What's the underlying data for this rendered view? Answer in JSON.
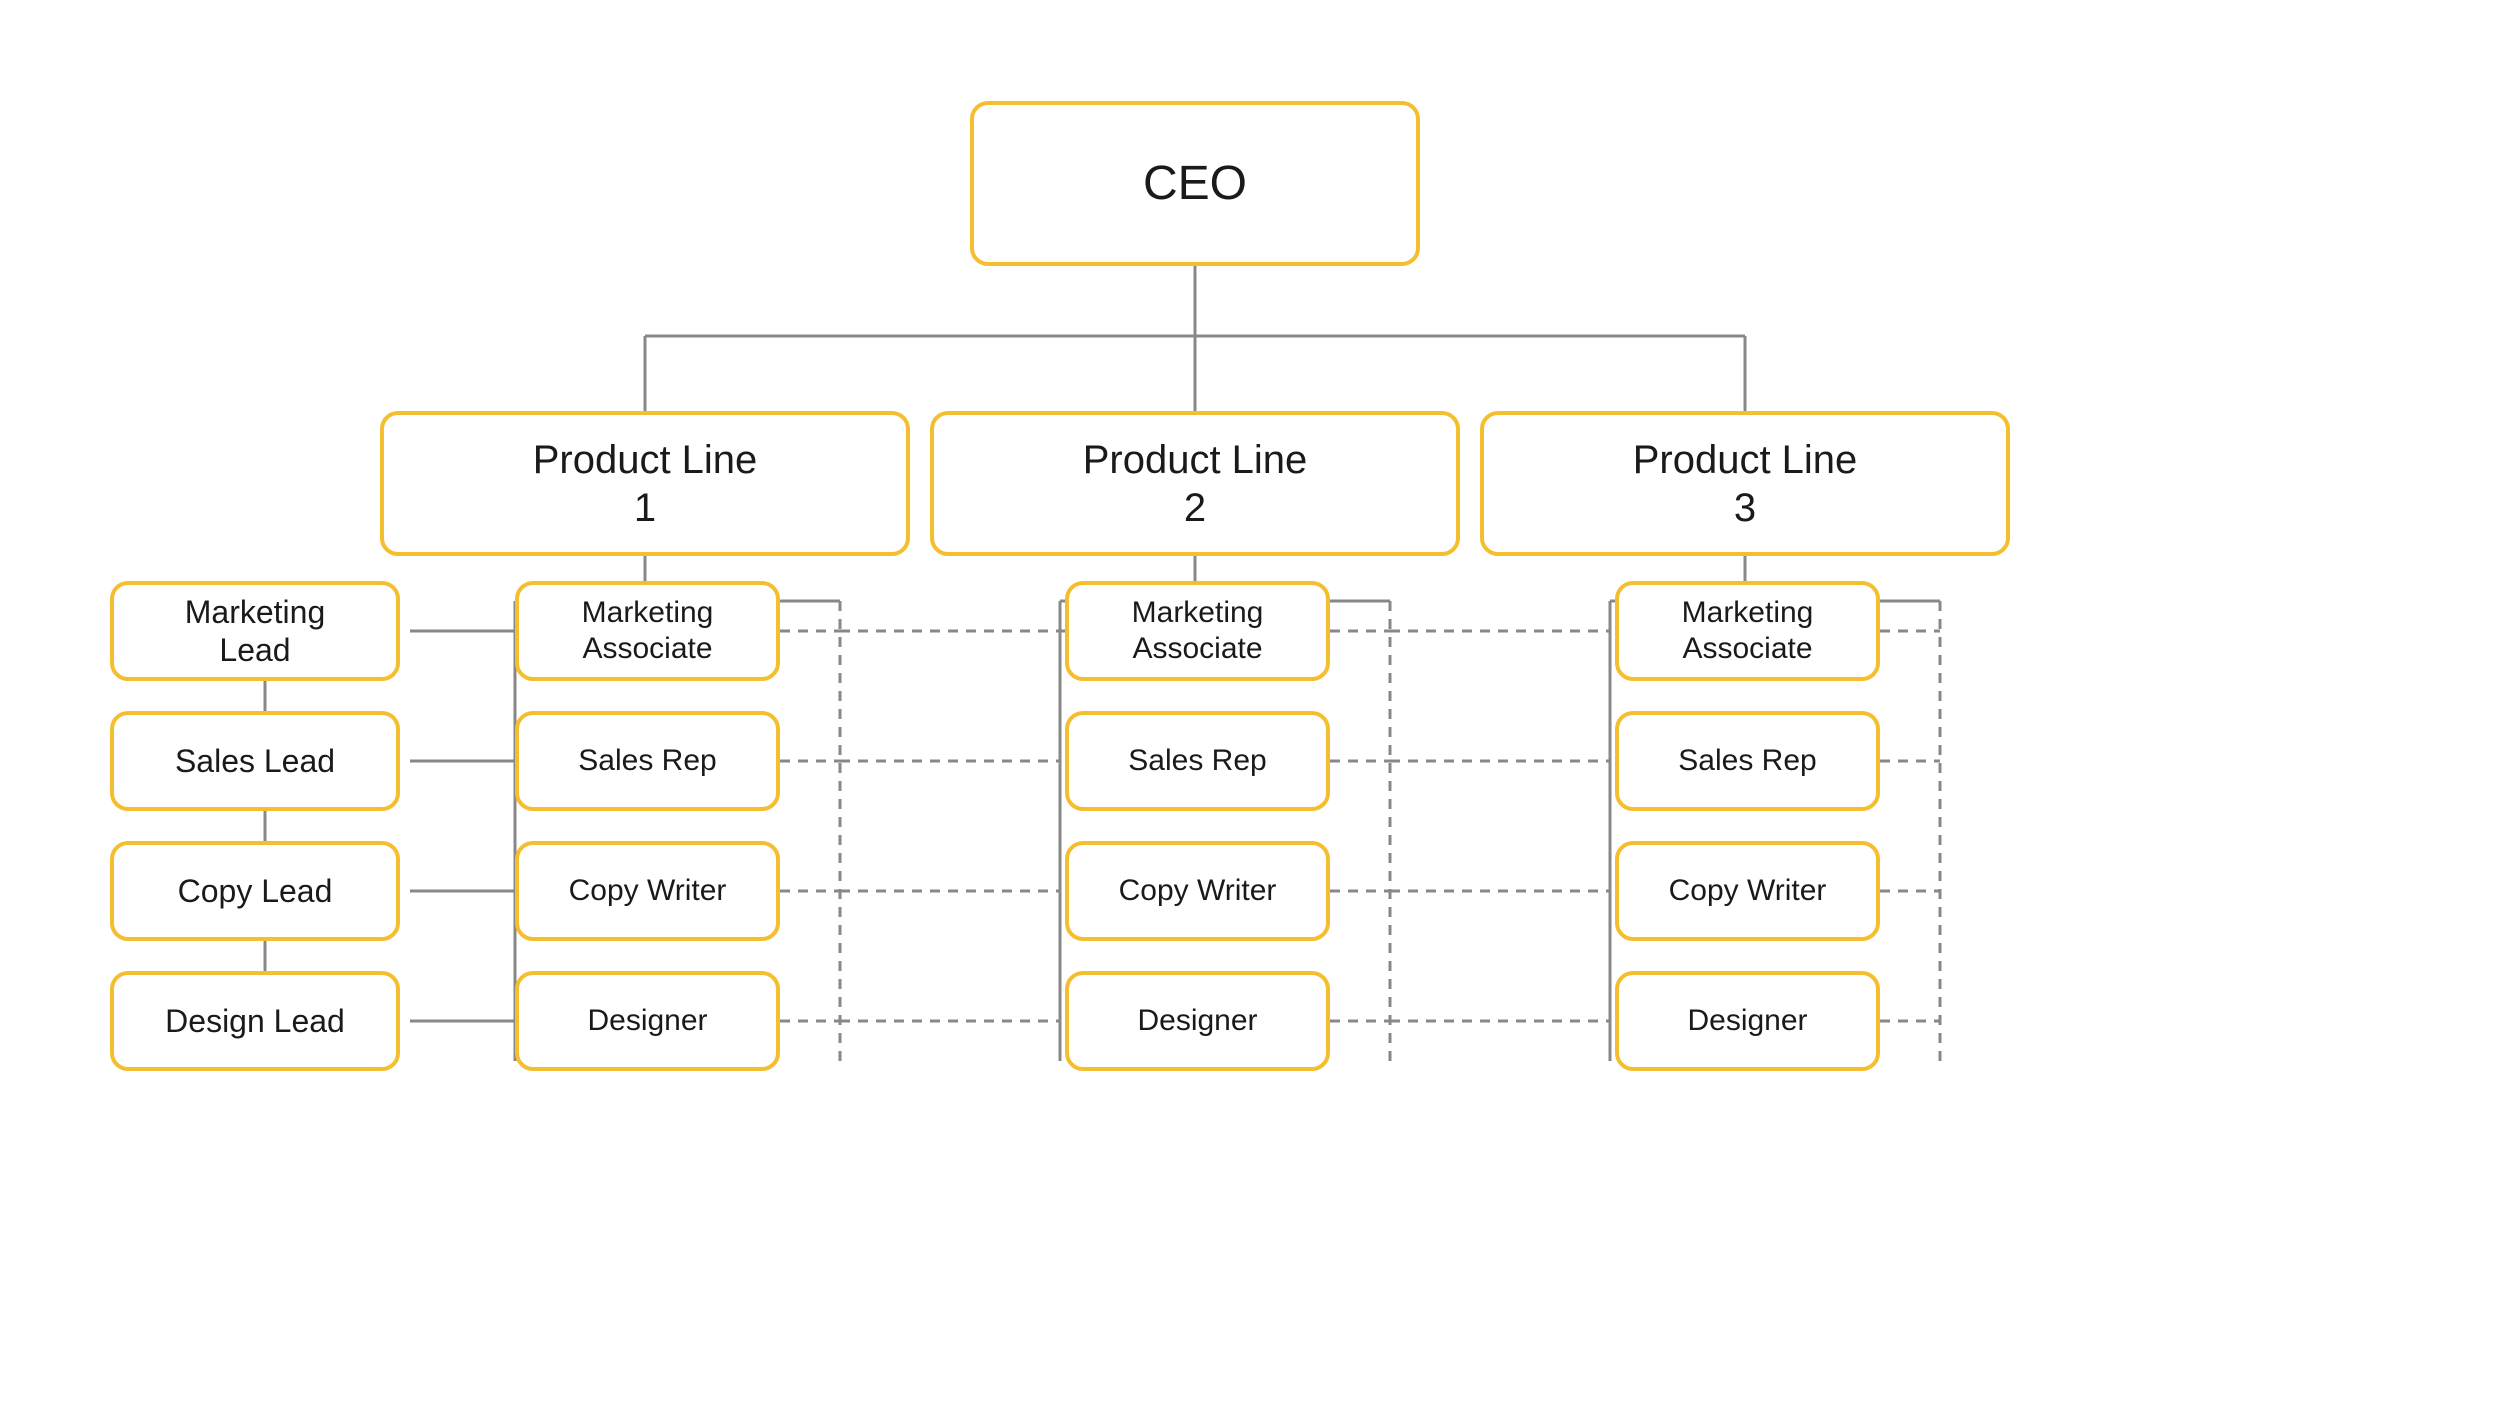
{
  "nodes": {
    "ceo": {
      "label": "CEO"
    },
    "pl1": {
      "label": "Product Line\n1"
    },
    "pl2": {
      "label": "Product Line\n2"
    },
    "pl3": {
      "label": "Product Line\n3"
    },
    "mktg_lead": {
      "label": "Marketing\nLead"
    },
    "sales_lead": {
      "label": "Sales Lead"
    },
    "copy_lead": {
      "label": "Copy Lead"
    },
    "design_lead": {
      "label": "Design Lead"
    },
    "ma1": {
      "label": "Marketing\nAssociate"
    },
    "sr1": {
      "label": "Sales Rep"
    },
    "cw1": {
      "label": "Copy Writer"
    },
    "d1": {
      "label": "Designer"
    },
    "ma2": {
      "label": "Marketing\nAssociate"
    },
    "sr2": {
      "label": "Sales Rep"
    },
    "cw2": {
      "label": "Copy Writer"
    },
    "d2": {
      "label": "Designer"
    },
    "ma3": {
      "label": "Marketing\nAssociate"
    },
    "sr3": {
      "label": "Sales Rep"
    },
    "cw3": {
      "label": "Copy Writer"
    },
    "d3": {
      "label": "Designer"
    }
  },
  "colors": {
    "border": "#F5BE2E",
    "line": "#888888",
    "dashed": "#888888"
  }
}
